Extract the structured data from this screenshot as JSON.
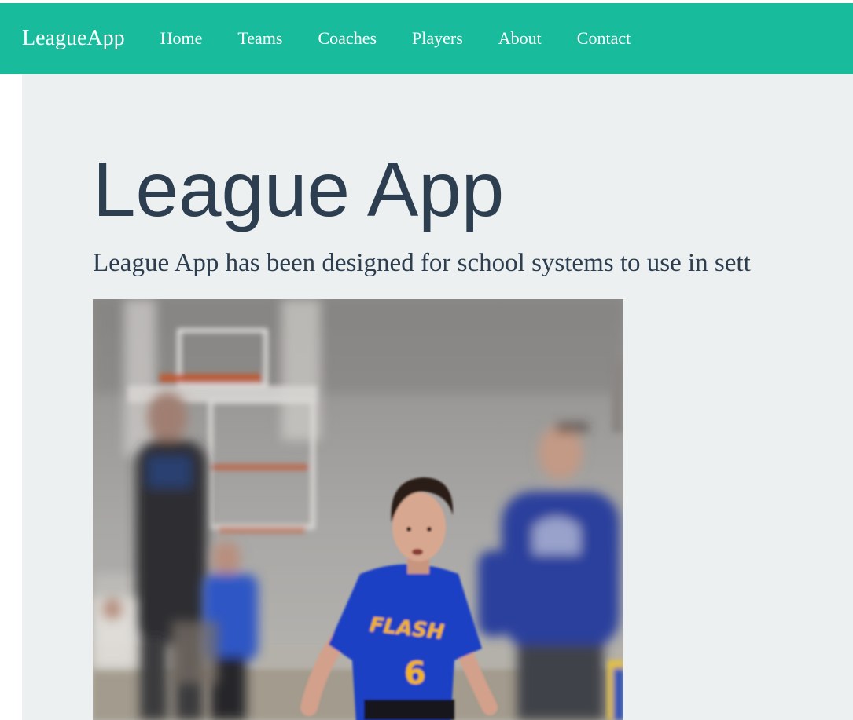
{
  "navbar": {
    "brand": "LeagueApp",
    "items": [
      {
        "label": "Home"
      },
      {
        "label": "Teams"
      },
      {
        "label": "Coaches"
      },
      {
        "label": "Players"
      },
      {
        "label": "About"
      },
      {
        "label": "Contact"
      }
    ],
    "background_color": "#18bc9c"
  },
  "jumbotron": {
    "title": "League App",
    "lead": "League App has been designed for school systems to use in sett",
    "background_color": "#ecf0f1",
    "text_color": "#2c3e50"
  },
  "hero_image": {
    "jersey_text": "FLASH",
    "jersey_number": "6"
  }
}
